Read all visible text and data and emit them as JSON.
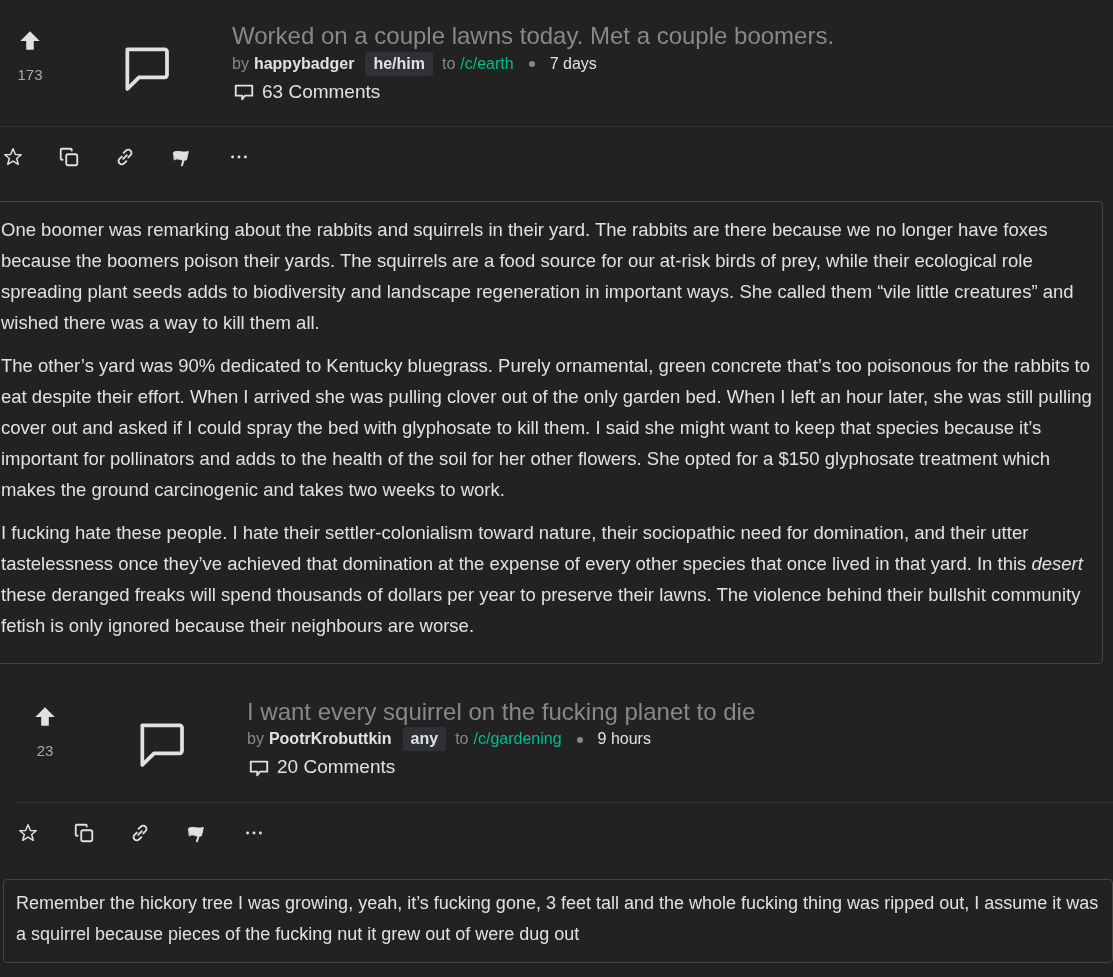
{
  "posts": [
    {
      "score": "173",
      "title": "Worked on a couple lawns today. Met a couple boomers.",
      "by": "by",
      "author": "happybadger",
      "author_tag": "he/him",
      "to": "to",
      "community": "/c/earth",
      "time": "7 days",
      "comments": "63 Comments",
      "body": [
        "One boomer was remarking about the rabbits and squirrels in their yard. The rabbits are there because we no longer have foxes because the boomers poison their yards. The squirrels are a food source for our at-risk birds of prey, while their ecological role spreading plant seeds adds to biodiversity and landscape regeneration in important ways. She called them “vile little creatures” and wished there was a way to kill them all.",
        "The other’s yard was 90% dedicated to Kentucky bluegrass. Purely ornamental, green concrete that’s too poisonous for the rabbits to eat despite their effort. When I arrived she was pulling clover out of the only garden bed. When I left an hour later, she was still pulling cover out and asked if I could spray the bed with glyphosate to kill them. I said she might want to keep that species because it’s important for pollinators and adds to the health of the soil for her other flowers. She opted for a $150 glyphosate treatment which makes the ground carcinogenic and takes two weeks to work.",
        "I fucking hate these people. I hate their settler-colonialism toward nature, their sociopathic need for domination, and their utter tastelessness once they’ve achieved that domination at the expense of every other species that once lived in that yard. In this *desert* these deranged freaks will spend thousands of dollars per year to preserve their lawns. The violence behind their bullshit community fetish is only ignored because their neighbours are worse."
      ]
    },
    {
      "score": "23",
      "title": "I want every squirrel on the fucking planet to die",
      "by": "by",
      "author": "PootrKrobuttkin",
      "author_tag": "any",
      "to": "to",
      "community": "/c/gardening",
      "time": "9 hours",
      "comments": "20 Comments",
      "body": [
        "Remember the hickory tree I was growing, yeah, it’s fucking gone, 3 feet tall and the whole fucking thing was ripped out, I assume it was a squirrel because pieces of the fucking nut it grew out of were dug out"
      ]
    }
  ]
}
